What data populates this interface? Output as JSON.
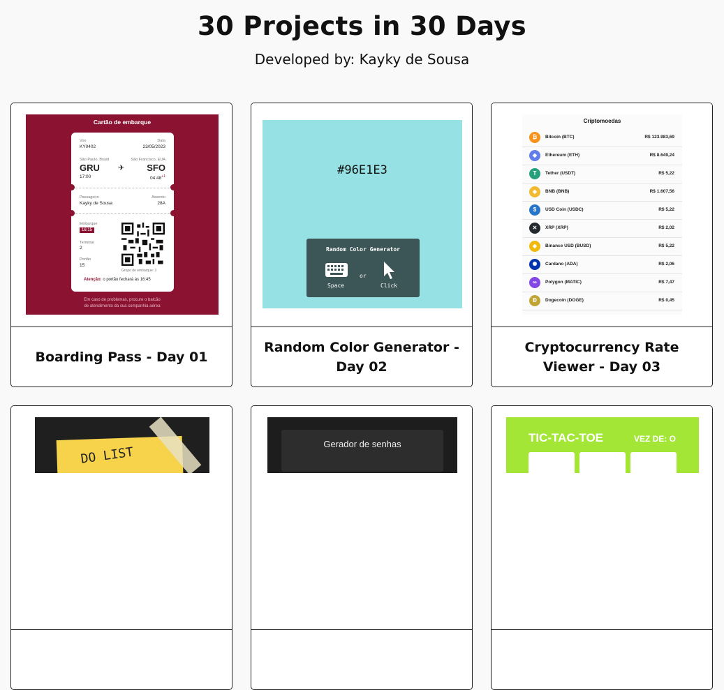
{
  "header": {
    "title": "30 Projects in 30 Days",
    "subtitle": "Developed by: Kayky de Sousa"
  },
  "cards": [
    {
      "caption": "Boarding Pass - Day 01",
      "preview": {
        "heading": "Cartão de embarque",
        "voo_label": "Voo",
        "voo": "KY0402",
        "data_label": "Data",
        "data": "23/05/2023",
        "from_city": "São Paulo, Brasil",
        "from_code": "GRU",
        "from_time": "17:00",
        "to_city": "São Francisco, EUA",
        "to_code": "SFO",
        "to_time": "04:48",
        "to_time_sup": "+1",
        "passenger_label": "Passageiro",
        "passenger": "Kayky de Sousa",
        "seat_label": "Assento",
        "seat": "28A",
        "boarding_label": "Embarque",
        "boarding": "16:15",
        "terminal_label": "Terminal",
        "terminal": "2",
        "gate_label": "Portão",
        "gate": "15",
        "group_label": "Grupo de embarque: 3",
        "warning_label": "Atenção:",
        "warning": "o portão fechará às 16:45",
        "footer_line1": "Em caso de problemas, procure o balcão",
        "footer_line2": "de atendimento da sua companhia aérea",
        "bg_color": "#8c1232"
      }
    },
    {
      "caption": "Random Color Generator - Day 02",
      "preview": {
        "hex": "#96E1E3",
        "panel_title": "Random Color Generator",
        "space_label": "Space",
        "or_label": "or",
        "click_label": "Click",
        "bg_color": "#96e1e3"
      }
    },
    {
      "caption": "Cryptocurrency Rate Viewer - Day 03",
      "preview": {
        "heading": "Criptomoedas",
        "coins": [
          {
            "name": "Bitcoin (BTC)",
            "price": "R$ 123.983,69",
            "color": "#f7931a",
            "symbol": "₿"
          },
          {
            "name": "Ethereum (ETH)",
            "price": "R$ 8.649,24",
            "color": "#627eea",
            "symbol": "◆"
          },
          {
            "name": "Tether (USDT)",
            "price": "R$ 5,22",
            "color": "#26a17b",
            "symbol": "T"
          },
          {
            "name": "BNB (BNB)",
            "price": "R$ 1.607,56",
            "color": "#f3ba2f",
            "symbol": "◈"
          },
          {
            "name": "USD Coin (USDC)",
            "price": "R$ 5,22",
            "color": "#2775ca",
            "symbol": "$"
          },
          {
            "name": "XRP (XRP)",
            "price": "R$ 2,02",
            "color": "#23292f",
            "symbol": "✕"
          },
          {
            "name": "Binance USD (BUSD)",
            "price": "R$ 5,22",
            "color": "#f0b90b",
            "symbol": "◈"
          },
          {
            "name": "Cardano (ADA)",
            "price": "R$ 2,06",
            "color": "#0033ad",
            "symbol": "✺"
          },
          {
            "name": "Polygon (MATIC)",
            "price": "R$ 7,47",
            "color": "#8247e5",
            "symbol": "∞"
          },
          {
            "name": "Dogecoin (DOGE)",
            "price": "R$ 0,45",
            "color": "#c2a633",
            "symbol": "Ð"
          }
        ]
      }
    },
    {
      "preview": {
        "note_text": "DO LIST"
      }
    },
    {
      "preview": {
        "box_title": "Gerador de senhas"
      }
    },
    {
      "preview": {
        "title": "TIC-TAC-TOE",
        "turn": "VEZ DE: O",
        "bg_color": "#a3e635"
      }
    }
  ]
}
